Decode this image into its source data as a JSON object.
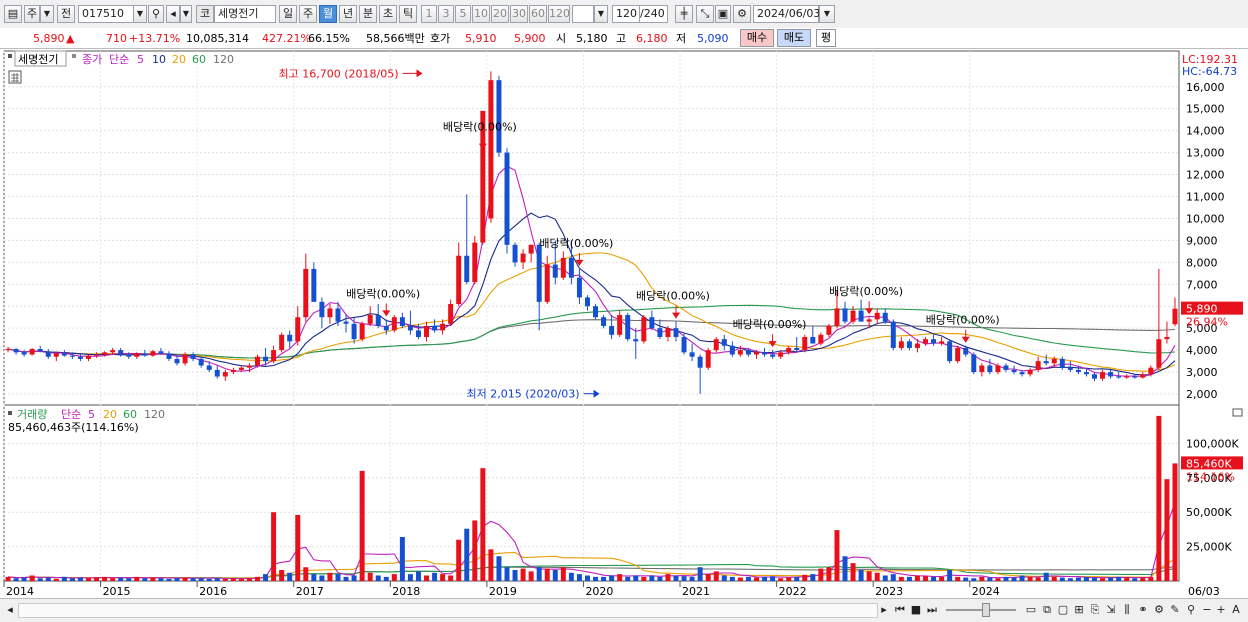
{
  "toolbar": {
    "market": "주",
    "prev": "전",
    "code": "017510",
    "badge": "코",
    "name": "세명전기",
    "periods": [
      "일",
      "주",
      "월",
      "년",
      "분",
      "초",
      "틱"
    ],
    "selected_period": "월",
    "intervals": [
      "1",
      "3",
      "5",
      "10",
      "20",
      "30",
      "60",
      "120"
    ],
    "count": "120",
    "count_total": "/240",
    "date": "2024/06/03"
  },
  "quote": {
    "price": "5,890",
    "change": "710",
    "change_pct": "+13.71%",
    "volume": "10,085,314",
    "vol_ratio": "427.21%",
    "turnover": "66.15%",
    "amount": "58,566백만",
    "ask_label": "호가",
    "ask1": "5,910",
    "bid1": "5,900",
    "open_label": "시",
    "open": "5,180",
    "high_label": "고",
    "high": "6,180",
    "low_label": "저",
    "low": "5,090",
    "buy": "매수",
    "sell": "매도",
    "eval": "평"
  },
  "price_panel": {
    "name": "세명전기",
    "legend": [
      "종가",
      "단순",
      "5",
      "10",
      "20",
      "60",
      "120"
    ],
    "lc": "LC:192.31",
    "hc": "HC:-64.73",
    "last_price": "5,890",
    "last_pct": "26.94%",
    "high_note": "최고 16,700 (2018/05)",
    "low_note": "최저 2,015 (2020/03)",
    "dividend_label": "배당락(0.00%)",
    "yticks": [
      "16,000",
      "15,000",
      "14,000",
      "13,000",
      "12,000",
      "11,000",
      "10,000",
      "9,000",
      "8,000",
      "7,000",
      "6,000",
      "5,000",
      "4,000",
      "3,000",
      "2,000"
    ]
  },
  "volume_panel": {
    "legend": [
      "거래량",
      "단순",
      "5",
      "20",
      "60",
      "120"
    ],
    "info": "85,460,463주(114.16%)",
    "yticks": [
      "100,000K",
      "75,000K",
      "50,000K",
      "25,000K"
    ],
    "last_volume": "85,460K",
    "last_pct": "114.16%"
  },
  "xticks": [
    "2014",
    "2015",
    "2016",
    "2017",
    "2018",
    "2019",
    "2020",
    "2021",
    "2022",
    "2023",
    "2024"
  ],
  "x_end_label": "06/03",
  "colors": {
    "up": "#e8101a",
    "down": "#1550d0",
    "ma5": "#c020c0",
    "ma10": "#1a2a8a",
    "ma20": "#e8a000",
    "ma60": "#2a9a50",
    "ma120": "#707070"
  },
  "chart_data": {
    "type": "candlestick",
    "period": "monthly",
    "start": "2014-01",
    "ohlc": [
      [
        4000,
        4150,
        3900,
        4050
      ],
      [
        4050,
        4100,
        3800,
        3900
      ],
      [
        3900,
        4000,
        3700,
        3800
      ],
      [
        3800,
        4100,
        3750,
        4050
      ],
      [
        4050,
        4200,
        3900,
        3950
      ],
      [
        3950,
        4050,
        3600,
        3700
      ],
      [
        3700,
        3900,
        3500,
        3850
      ],
      [
        3850,
        4000,
        3700,
        3750
      ],
      [
        3750,
        3900,
        3600,
        3700
      ],
      [
        3700,
        3800,
        3500,
        3600
      ],
      [
        3600,
        3800,
        3500,
        3750
      ],
      [
        3750,
        3900,
        3650,
        3800
      ],
      [
        3800,
        3950,
        3700,
        3900
      ],
      [
        3900,
        4100,
        3800,
        4000
      ],
      [
        4000,
        4100,
        3700,
        3800
      ],
      [
        3800,
        3900,
        3600,
        3700
      ],
      [
        3700,
        3900,
        3600,
        3850
      ],
      [
        3850,
        4000,
        3700,
        3750
      ],
      [
        3750,
        4000,
        3700,
        3950
      ],
      [
        3950,
        4100,
        3800,
        3850
      ],
      [
        3850,
        3950,
        3500,
        3600
      ],
      [
        3600,
        3800,
        3300,
        3400
      ],
      [
        3400,
        3900,
        3300,
        3800
      ],
      [
        3800,
        3900,
        3500,
        3600
      ],
      [
        3600,
        3700,
        3200,
        3300
      ],
      [
        3300,
        3500,
        3000,
        3100
      ],
      [
        3100,
        3300,
        2700,
        2800
      ],
      [
        2800,
        3100,
        2600,
        3000
      ],
      [
        3000,
        3200,
        2900,
        3100
      ],
      [
        3100,
        3300,
        3000,
        3200
      ],
      [
        3200,
        3400,
        3000,
        3300
      ],
      [
        3300,
        3800,
        3200,
        3700
      ],
      [
        3700,
        4100,
        3300,
        3500
      ],
      [
        3500,
        4200,
        3400,
        4000
      ],
      [
        4000,
        4800,
        3900,
        4700
      ],
      [
        4700,
        4900,
        4100,
        4400
      ],
      [
        4400,
        6000,
        4200,
        5500
      ],
      [
        5500,
        8400,
        5300,
        7700
      ],
      [
        7700,
        8000,
        6200,
        6200
      ],
      [
        6200,
        6400,
        5000,
        5500
      ],
      [
        5500,
        6100,
        5200,
        5900
      ],
      [
        5900,
        6200,
        5100,
        5300
      ],
      [
        5300,
        5600,
        4800,
        5200
      ],
      [
        5200,
        5500,
        4300,
        4500
      ],
      [
        4500,
        5300,
        4400,
        5200
      ],
      [
        5200,
        6000,
        5100,
        5600
      ],
      [
        5600,
        6100,
        5000,
        5100
      ],
      [
        5100,
        5400,
        4700,
        4900
      ],
      [
        4900,
        5600,
        4800,
        5500
      ],
      [
        5500,
        5700,
        5000,
        5100
      ],
      [
        5100,
        5800,
        4700,
        4900
      ],
      [
        4900,
        5200,
        4500,
        4600
      ],
      [
        4600,
        5300,
        4400,
        5100
      ],
      [
        5100,
        5400,
        4800,
        4900
      ],
      [
        4900,
        5400,
        4700,
        5200
      ],
      [
        5200,
        6300,
        5100,
        6100
      ],
      [
        6100,
        8900,
        6000,
        8300
      ],
      [
        8300,
        11100,
        7000,
        7100
      ],
      [
        7100,
        9200,
        7000,
        8900
      ],
      [
        8900,
        13000,
        8800,
        14900
      ],
      [
        10000,
        16700,
        9800,
        16300
      ],
      [
        16300,
        16500,
        12800,
        13000
      ],
      [
        13000,
        13200,
        8400,
        8800
      ],
      [
        8800,
        8900,
        7800,
        8000
      ],
      [
        8000,
        8600,
        7700,
        8400
      ],
      [
        8400,
        8800,
        8000,
        8800
      ],
      [
        8800,
        8900,
        4900,
        6200
      ],
      [
        6200,
        8300,
        6100,
        7900
      ],
      [
        7900,
        9000,
        7000,
        7300
      ],
      [
        7300,
        8500,
        7200,
        8200
      ],
      [
        8200,
        9000,
        7000,
        7300
      ],
      [
        7300,
        7700,
        6100,
        6400
      ],
      [
        6400,
        6500,
        5800,
        6000
      ],
      [
        6000,
        6100,
        5400,
        5500
      ],
      [
        5500,
        5600,
        5000,
        5100
      ],
      [
        5100,
        5600,
        4500,
        4700
      ],
      [
        4700,
        5800,
        4600,
        5600
      ],
      [
        5600,
        5700,
        4400,
        4500
      ],
      [
        4500,
        5000,
        3600,
        4400
      ],
      [
        4400,
        5600,
        4300,
        5500
      ],
      [
        5500,
        5800,
        4900,
        5000
      ],
      [
        5000,
        5400,
        4500,
        4600
      ],
      [
        4600,
        5100,
        4400,
        5000
      ],
      [
        5000,
        5300,
        4400,
        4600
      ],
      [
        4600,
        4800,
        3800,
        3900
      ],
      [
        3900,
        4300,
        3500,
        3700
      ],
      [
        3700,
        3800,
        2015,
        3200
      ],
      [
        3200,
        4100,
        3100,
        4000
      ],
      [
        4000,
        4600,
        3900,
        4500
      ],
      [
        4500,
        4700,
        4000,
        4200
      ],
      [
        4200,
        4400,
        3700,
        3800
      ],
      [
        3800,
        4200,
        3700,
        4000
      ],
      [
        4000,
        4100,
        3700,
        3800
      ],
      [
        3800,
        4000,
        3600,
        3900
      ],
      [
        3900,
        4100,
        3700,
        3800
      ],
      [
        3800,
        4000,
        3600,
        3700
      ],
      [
        3700,
        4000,
        3600,
        3900
      ],
      [
        3900,
        4200,
        3800,
        4100
      ],
      [
        4100,
        4600,
        3900,
        4000
      ],
      [
        4000,
        4700,
        3900,
        4600
      ],
      [
        4600,
        5100,
        4400,
        4300
      ],
      [
        4300,
        4800,
        4200,
        4700
      ],
      [
        4700,
        5200,
        4600,
        5100
      ],
      [
        5100,
        6700,
        5000,
        5900
      ],
      [
        5900,
        6200,
        5200,
        5300
      ],
      [
        5300,
        6000,
        5200,
        5800
      ],
      [
        5800,
        6300,
        5300,
        5300
      ],
      [
        5300,
        5500,
        5000,
        5400
      ],
      [
        5400,
        5900,
        5200,
        5700
      ],
      [
        5700,
        5900,
        5200,
        5300
      ],
      [
        5300,
        5400,
        4000,
        4100
      ],
      [
        4100,
        4600,
        4000,
        4400
      ],
      [
        4400,
        4500,
        4000,
        4100
      ],
      [
        4100,
        4500,
        3900,
        4300
      ],
      [
        4300,
        4600,
        4200,
        4500
      ],
      [
        4500,
        4700,
        4200,
        4300
      ],
      [
        4300,
        4600,
        4200,
        4400
      ],
      [
        4400,
        4500,
        3400,
        3500
      ],
      [
        3500,
        4200,
        3400,
        4100
      ],
      [
        4100,
        4200,
        3700,
        3800
      ],
      [
        3800,
        3900,
        2900,
        3000
      ],
      [
        3000,
        3400,
        2800,
        3300
      ],
      [
        3300,
        3600,
        2900,
        3000
      ],
      [
        3000,
        3400,
        2900,
        3300
      ],
      [
        3300,
        3400,
        3000,
        3100
      ],
      [
        3100,
        3300,
        2900,
        3000
      ],
      [
        3000,
        3100,
        2800,
        2900
      ],
      [
        2900,
        3200,
        2800,
        3100
      ],
      [
        3100,
        3700,
        3000,
        3500
      ],
      [
        3500,
        3800,
        3300,
        3400
      ],
      [
        3400,
        3700,
        3200,
        3600
      ],
      [
        3600,
        3700,
        3100,
        3200
      ],
      [
        3200,
        3500,
        3000,
        3100
      ],
      [
        3100,
        3300,
        2900,
        3000
      ],
      [
        3000,
        3200,
        2800,
        2900
      ],
      [
        2900,
        3000,
        2600,
        2700
      ],
      [
        2700,
        3100,
        2600,
        3000
      ],
      [
        3000,
        3100,
        2700,
        2800
      ],
      [
        2800,
        3000,
        2700,
        2750
      ],
      [
        2750,
        2900,
        2700,
        2800
      ],
      [
        2800,
        2900,
        2700,
        2750
      ],
      [
        2750,
        3000,
        2700,
        2900
      ],
      [
        2900,
        3300,
        2800,
        3200
      ],
      [
        3200,
        7700,
        3100,
        4500
      ],
      [
        4500,
        5300,
        4300,
        4600
      ],
      [
        5180,
        6400,
        5090,
        5890
      ]
    ],
    "volume_k": [
      3000,
      2000,
      2500,
      4000,
      2000,
      2500,
      1500,
      3000,
      2000,
      2500,
      2000,
      2500,
      3000,
      2000,
      2500,
      2000,
      3000,
      2000,
      2500,
      2000,
      1500,
      2000,
      2500,
      2000,
      2000,
      1500,
      2000,
      1500,
      2000,
      1500,
      2000,
      3000,
      5000,
      50000,
      8000,
      6000,
      48000,
      10000,
      5000,
      4000,
      6000,
      5000,
      3000,
      4000,
      80000,
      6000,
      4000,
      3000,
      5000,
      32000,
      5000,
      7000,
      4000,
      6000,
      5000,
      4000,
      30000,
      38000,
      44000,
      82000,
      23000,
      18000,
      10000,
      8000,
      9000,
      7000,
      10000,
      9000,
      8000,
      10000,
      6000,
      5000,
      4000,
      3000,
      3000,
      4000,
      5000,
      3000,
      4000,
      3000,
      4000,
      3000,
      5000,
      4000,
      3500,
      3000,
      10000,
      5000,
      7000,
      4000,
      3000,
      2500,
      3000,
      2500,
      3000,
      3500,
      2000,
      2500,
      3000,
      4500,
      5000,
      9000,
      10000,
      37000,
      18000,
      13000,
      8000,
      7000,
      6000,
      4000,
      5000,
      3000,
      3000,
      4000,
      3500,
      3000,
      3000,
      8000,
      3000,
      2500,
      2000,
      3000,
      2500,
      2000,
      3000,
      2500,
      4000,
      3000,
      2500,
      6000,
      3000,
      2500,
      2000,
      2500,
      3000,
      2500,
      2000,
      2500,
      3000,
      2500,
      2000,
      2500,
      3000,
      120000,
      74000,
      85460
    ],
    "xlabels": [
      "2014",
      "2015",
      "2016",
      "2017",
      "2018",
      "2019",
      "2020",
      "2021",
      "2022",
      "2023",
      "2024"
    ],
    "ylim_price": [
      1500,
      16900
    ],
    "ylim_volume_k": [
      0,
      125000
    ],
    "grid": true,
    "annotations": {
      "high": {
        "value": 16700,
        "date": "2018/05"
      },
      "low": {
        "value": 2015,
        "date": "2020/03"
      },
      "dividend_months": [
        "2017-12",
        "2018-12",
        "2019-12",
        "2020-12",
        "2021-12",
        "2022-12",
        "2023-12"
      ]
    }
  }
}
